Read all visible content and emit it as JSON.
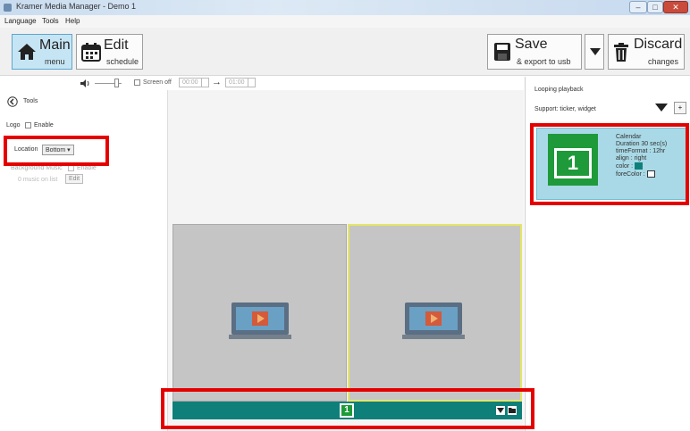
{
  "window": {
    "title": "Kramer Media Manager - Demo 1",
    "minimize": "–",
    "maximize": "□",
    "close": "✕"
  },
  "menu": {
    "items": [
      "Language",
      "Tools",
      "Help"
    ]
  },
  "toolbar": {
    "main": {
      "big": "Main",
      "small": "menu"
    },
    "edit": {
      "big": "Edit",
      "small": "schedule"
    },
    "save": {
      "big": "Save",
      "small": "& export to usb"
    },
    "discard": {
      "big": "Discard",
      "small": "changes"
    }
  },
  "controls": {
    "screen_off_label": "Screen off",
    "time_from": "00:00",
    "time_to": "01:00",
    "arrow": "→"
  },
  "tools": {
    "header": "Tools",
    "logo_label": "Logo",
    "logo_enable": "Enable",
    "location_label": "Location",
    "location_value": "Bottom",
    "bg_music_label": "Background Music",
    "bg_music_enable": "Enable",
    "music_status": "0 music on list",
    "edit_button": "Edit"
  },
  "right": {
    "looping_label": "Looping playback",
    "support_label": "Support: ticker, widget",
    "plus": "+"
  },
  "widget": {
    "name": "Calendar",
    "duration": "Duration  30  sec(s)",
    "time_format": "timeFormat :  12hr",
    "align": "align :  right",
    "color_label": "color :",
    "fore_color_label": "foreColor :",
    "calendar_number": "1"
  },
  "ticker": {
    "calendar_number": "1"
  },
  "colors": {
    "ticker": "#0f7f7a",
    "widget_bg": "#a9d9e6",
    "calendar_green": "#1e9a3a",
    "highlight": "#e50000"
  }
}
